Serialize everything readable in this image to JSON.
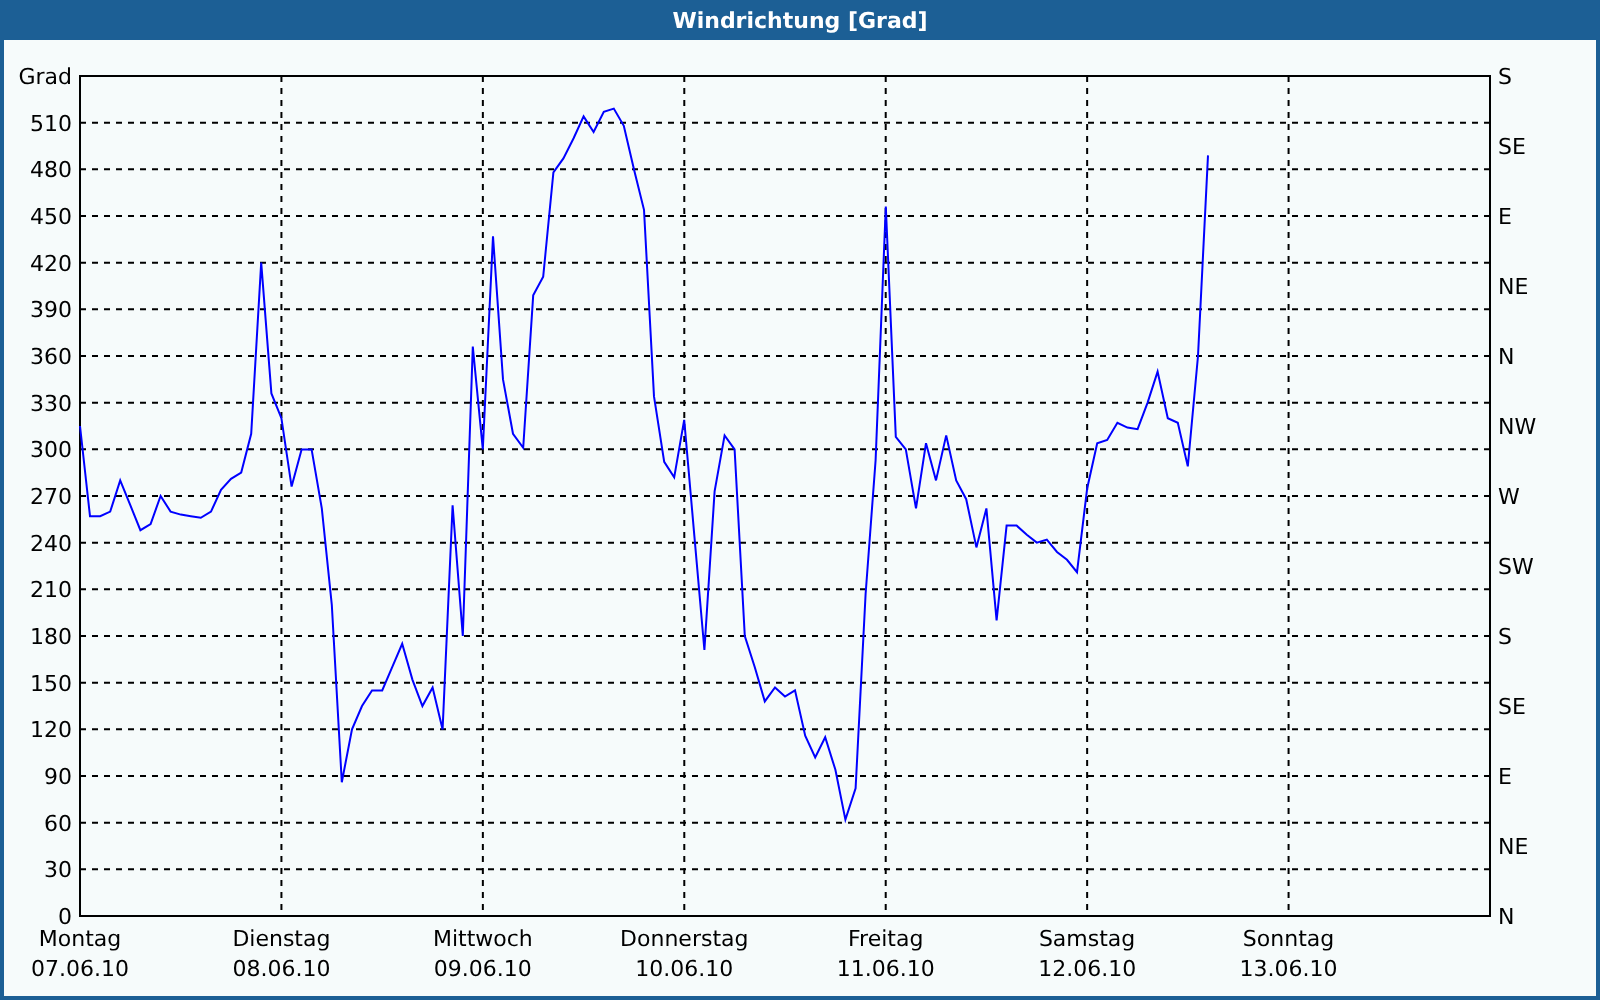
{
  "window": {
    "title": "Windrichtung [Grad]"
  },
  "chart": {
    "chart_data": {
      "type": "line",
      "grid": true,
      "ylabel": "Grad",
      "ylim": [
        0,
        540
      ],
      "categories": [
        "07.06.10",
        null,
        null,
        null,
        null,
        null,
        null,
        null,
        null,
        null,
        null,
        null,
        null,
        null,
        null,
        null,
        null,
        null,
        null,
        null,
        "08.06.10",
        null,
        null,
        null,
        null,
        null,
        null,
        null,
        null,
        null,
        null,
        null,
        null,
        null,
        null,
        null,
        null,
        null,
        null,
        null,
        "09.06.10",
        null,
        null,
        null,
        null,
        null,
        null,
        null,
        null,
        null,
        null,
        null,
        null,
        null,
        null,
        null,
        null,
        null,
        null,
        null,
        "10.06.10",
        null,
        null,
        null,
        null,
        null,
        null,
        null,
        null,
        null,
        null,
        null,
        null,
        null,
        null,
        null,
        null,
        null,
        null,
        null,
        "11.06.10",
        null,
        null,
        null,
        null,
        null,
        null,
        null,
        null,
        null,
        null,
        null,
        null,
        null,
        null,
        null,
        null,
        null,
        null,
        null,
        "12.06.10",
        null,
        null,
        null,
        null,
        null,
        null,
        null,
        null,
        null,
        null,
        null,
        null,
        null,
        null,
        null,
        null,
        null,
        null,
        null,
        "13.06.10",
        null,
        null,
        null,
        null,
        null,
        null,
        null,
        null,
        null,
        null,
        null,
        null,
        null,
        null,
        null,
        null,
        null,
        null,
        null,
        null
      ],
      "yticks": [
        0,
        30,
        60,
        90,
        120,
        150,
        180,
        210,
        240,
        270,
        300,
        330,
        360,
        390,
        420,
        450,
        480,
        510
      ],
      "series": [
        {
          "color": "#0000ff",
          "values": [
            315,
            257,
            257,
            260,
            280,
            264,
            248,
            252,
            270,
            260,
            258,
            257,
            256,
            260,
            274,
            281,
            285,
            310,
            420,
            336,
            320,
            276,
            300,
            300,
            262,
            200,
            86,
            120,
            135,
            145,
            145,
            160,
            175,
            152,
            135,
            147,
            120,
            264,
            180,
            366,
            300,
            437,
            345,
            310,
            301,
            399,
            411,
            478,
            487,
            500,
            514,
            504,
            517,
            519,
            508,
            480,
            454,
            334,
            292,
            282,
            319,
            244,
            171,
            273,
            309,
            300,
            180,
            160,
            138,
            147,
            141,
            145,
            116,
            102,
            115,
            94,
            62,
            82,
            207,
            293,
            456,
            308,
            300,
            262,
            304,
            280,
            309,
            280,
            268,
            237,
            262,
            190,
            251,
            251,
            245,
            240,
            242,
            234,
            229,
            221,
            275,
            304,
            306,
            317,
            314,
            313,
            330,
            350,
            320,
            317,
            289,
            360,
            489,
            null,
            null,
            null,
            null,
            null,
            null,
            null,
            null,
            null,
            null,
            null,
            null,
            null,
            null,
            null,
            null,
            null,
            null,
            null,
            null,
            null,
            null,
            null,
            null,
            null,
            null,
            null,
            null
          ]
        }
      ]
    },
    "x_days": [
      "Montag",
      "Dienstag",
      "Mittwoch",
      "Donnerstag",
      "Freitag",
      "Samstag",
      "Sonntag"
    ],
    "right_axis": [
      "S",
      "SE",
      "E",
      "NE",
      "N",
      "NW",
      "W",
      "SW",
      "S",
      "SE",
      "E",
      "NE",
      "N"
    ]
  }
}
